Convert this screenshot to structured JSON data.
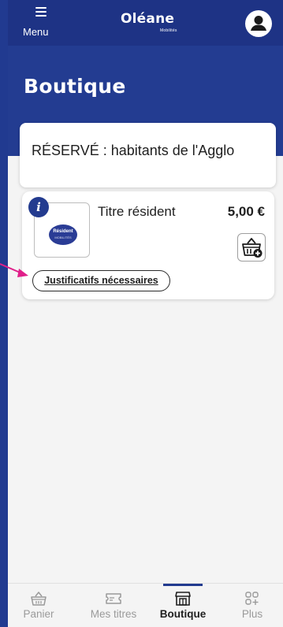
{
  "header": {
    "menu_label": "Menu",
    "logo_text": "Oléane",
    "logo_subtext": "Mobilités"
  },
  "page": {
    "title": "Boutique"
  },
  "banner": {
    "text": "RÉSERVÉ : habitants de l'Agglo"
  },
  "product": {
    "name": "Titre résident",
    "price": "5,00 €",
    "thumb_label": "Résident",
    "thumb_sublabel": "MOBILITÉS",
    "info_icon": "i",
    "justif_label": "Justificatifs nécessaires"
  },
  "tabs": [
    {
      "label": "Panier",
      "icon": "basket-icon",
      "active": false
    },
    {
      "label": "Mes titres",
      "icon": "ticket-icon",
      "active": false
    },
    {
      "label": "Boutique",
      "icon": "shop-icon",
      "active": true
    },
    {
      "label": "Plus",
      "icon": "grid-plus-icon",
      "active": false
    }
  ],
  "colors": {
    "brand_blue": "#21398f",
    "arrow": "#e0208a",
    "content_bg": "#f4f4f4"
  }
}
